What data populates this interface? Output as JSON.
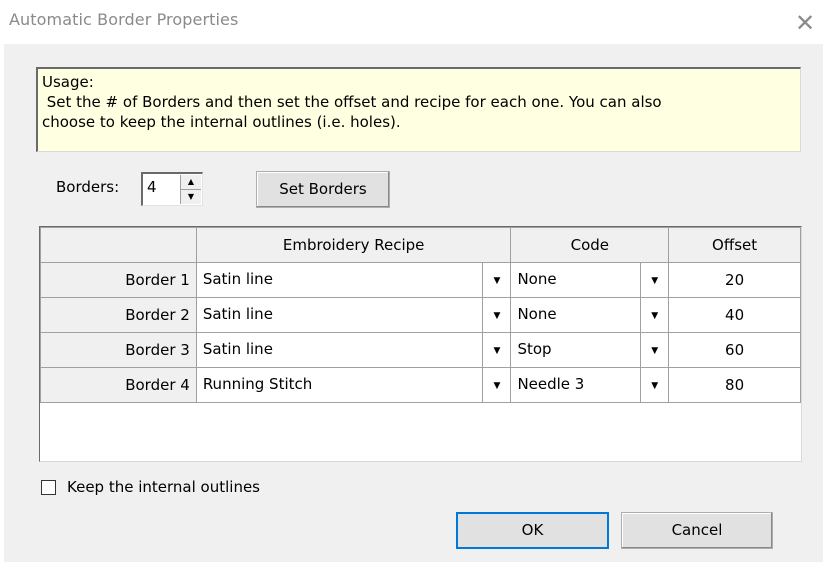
{
  "window": {
    "title": "Automatic Border Properties",
    "close_glyph": "✕"
  },
  "usage": {
    "heading": "Usage:",
    "line1": " Set the # of Borders and then set the offset and recipe for each one. You can also",
    "line2": "choose to keep the internal outlines (i.e. holes)."
  },
  "borders": {
    "label": "Borders:",
    "value": "4",
    "set_button_label": "Set Borders"
  },
  "grid": {
    "headers": [
      "",
      "Embroidery Recipe",
      "Code",
      "Offset"
    ],
    "rows": [
      {
        "label": "Border 1",
        "recipe": "Satin line",
        "code": "None",
        "offset": "20"
      },
      {
        "label": "Border 2",
        "recipe": "Satin line",
        "code": "None",
        "offset": "40"
      },
      {
        "label": "Border 3",
        "recipe": "Satin line",
        "code": "Stop",
        "offset": "60"
      },
      {
        "label": "Border 4",
        "recipe": "Running Stitch",
        "code": "Needle 3",
        "offset": "80"
      }
    ]
  },
  "options": {
    "keep_outlines_label": "Keep the internal outlines",
    "keep_outlines_checked": false
  },
  "footer": {
    "ok_label": "OK",
    "cancel_label": "Cancel"
  },
  "icons": {
    "close": "close-icon",
    "spin_up": "spin-up-arrow-icon",
    "spin_down": "spin-down-arrow-icon",
    "dropdown": "dropdown-arrow-icon"
  },
  "colors": {
    "usage_bg": "#ffffe1",
    "dialog_bg": "#f0f0f0",
    "default_button_border": "#0078d7"
  }
}
